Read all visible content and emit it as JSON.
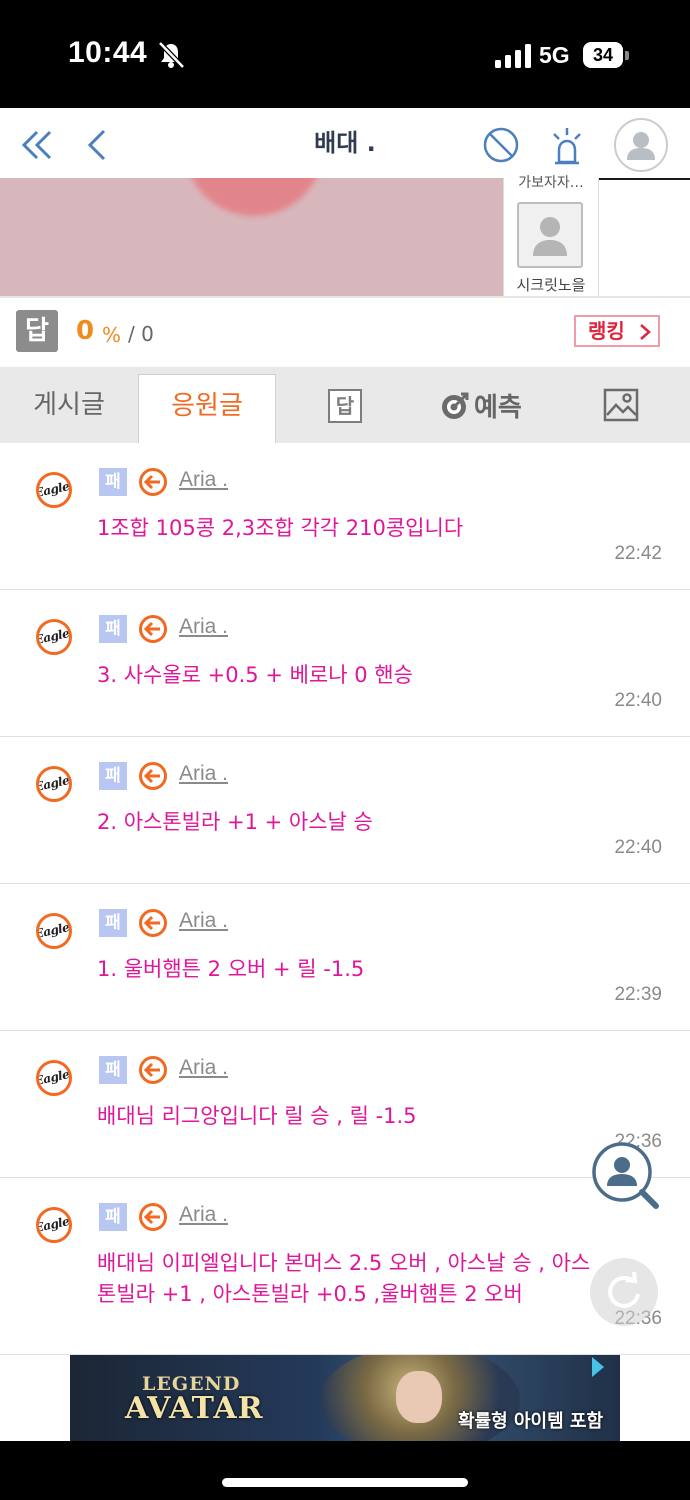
{
  "status_bar": {
    "time": "10:44",
    "network": "5G",
    "battery": "34"
  },
  "header": {
    "title": "배대 .",
    "icons": [
      "double-chevron-left-icon",
      "chevron-left-icon",
      "block-icon",
      "siren-icon",
      "user-avatar-icon"
    ]
  },
  "side_user": {
    "top_label": "가보자자…",
    "name": "시크릿노을"
  },
  "stats": {
    "badge": "답",
    "percent": "0",
    "percent_sign": "%",
    "count": "/ 0",
    "ranking_label": "랭킹"
  },
  "tabs": {
    "posts": "게시글",
    "cheer": "응원글",
    "answer": "답",
    "predict": "예측",
    "active": "cheer"
  },
  "comments": [
    {
      "badge": "패",
      "team_logo": "Eagles",
      "author": "Aria .",
      "text": "1조합 105콩 2,3조합 각각 210콩입니다",
      "time": "22:42"
    },
    {
      "badge": "패",
      "team_logo": "Eagles",
      "author": "Aria .",
      "text": "3. 사수올로 +0.5 + 베로나 0 핸승",
      "time": "22:40"
    },
    {
      "badge": "패",
      "team_logo": "Eagles",
      "author": "Aria .",
      "text": "2. 아스톤빌라 +1 + 아스날 승",
      "time": "22:40"
    },
    {
      "badge": "패",
      "team_logo": "Eagles",
      "author": "Aria .",
      "text": "1. 울버햄튼 2 오버 + 릴 -1.5",
      "time": "22:39"
    },
    {
      "badge": "패",
      "team_logo": "Eagles",
      "author": "Aria .",
      "text": "배대님 리그앙입니다 릴 승 , 릴 -1.5",
      "time": "22:36"
    },
    {
      "badge": "패",
      "team_logo": "Eagles",
      "author": "Aria .",
      "text": "배대님 이피엘입니다 본머스 2.5 오버 , 아스날 승 , 아스톤빌라 +1 , 아스톤빌라 +0.5 ,울버햄튼 2 오버",
      "time": "22:36"
    }
  ],
  "ad": {
    "logo_line1": "LEGEND",
    "logo_line2": "AVATAR",
    "caption": "확률형 아이템 포함"
  },
  "colors": {
    "accent_orange": "#f26a21",
    "comment_text": "#e0169a",
    "header_title": "#2f3c50",
    "icon_blue": "#4a7fc0",
    "ranking_red": "#e0263f"
  }
}
